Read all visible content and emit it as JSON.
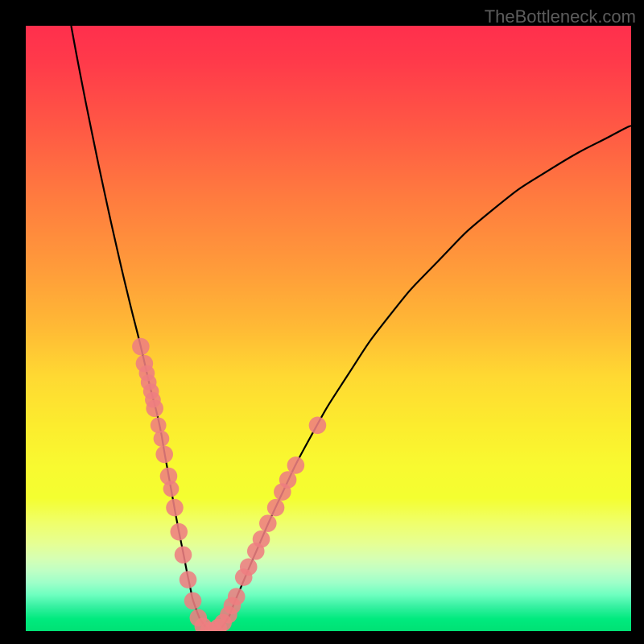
{
  "watermark": "TheBottleneck.com",
  "colors": {
    "frame": "#000000",
    "curve": "#000000",
    "dot_fill": "#ee7e81",
    "dot_stroke": "#ee7e81"
  },
  "chart_data": {
    "type": "line",
    "title": "",
    "xlabel": "",
    "ylabel": "",
    "xlim": [
      0,
      100
    ],
    "ylim": [
      0,
      100
    ],
    "series": [
      {
        "name": "bottleneck-curve",
        "x": [
          7.5,
          9,
          11,
          13,
          15,
          17,
          19,
          20.5,
          22,
          23,
          24,
          25,
          26,
          27,
          28,
          29.5,
          31,
          33,
          35,
          38,
          42,
          47,
          53,
          60,
          68,
          77,
          87,
          97,
          100
        ],
        "y": [
          100,
          92,
          82,
          72.5,
          63.5,
          55,
          47,
          40.5,
          34.5,
          29,
          23.5,
          18,
          13,
          8,
          4,
          1,
          0,
          1.5,
          6,
          13,
          22,
          32,
          42,
          52,
          61,
          69.5,
          76.5,
          82,
          83.5
        ]
      }
    ],
    "dots": [
      {
        "x": 19.0,
        "y": 47.0,
        "r": 1.2
      },
      {
        "x": 19.6,
        "y": 44.2,
        "r": 1.2
      },
      {
        "x": 20.0,
        "y": 42.6,
        "r": 1.0
      },
      {
        "x": 20.3,
        "y": 41.1,
        "r": 1.0
      },
      {
        "x": 20.7,
        "y": 39.6,
        "r": 1.0
      },
      {
        "x": 21.0,
        "y": 38.2,
        "r": 1.0
      },
      {
        "x": 21.3,
        "y": 36.8,
        "r": 1.2
      },
      {
        "x": 21.9,
        "y": 34.0,
        "r": 1.0
      },
      {
        "x": 22.4,
        "y": 31.8,
        "r": 1.0
      },
      {
        "x": 22.9,
        "y": 29.2,
        "r": 1.2
      },
      {
        "x": 23.6,
        "y": 25.6,
        "r": 1.2
      },
      {
        "x": 24.0,
        "y": 23.5,
        "r": 1.0
      },
      {
        "x": 24.6,
        "y": 20.4,
        "r": 1.2
      },
      {
        "x": 25.3,
        "y": 16.4,
        "r": 1.2
      },
      {
        "x": 26.0,
        "y": 12.6,
        "r": 1.2
      },
      {
        "x": 26.8,
        "y": 8.5,
        "r": 1.2
      },
      {
        "x": 27.6,
        "y": 5.0,
        "r": 1.2
      },
      {
        "x": 28.5,
        "y": 2.2,
        "r": 1.2
      },
      {
        "x": 29.3,
        "y": 0.8,
        "r": 1.2
      },
      {
        "x": 30.2,
        "y": 0.1,
        "r": 1.2
      },
      {
        "x": 31.0,
        "y": 0.1,
        "r": 1.2
      },
      {
        "x": 31.8,
        "y": 0.6,
        "r": 1.2
      },
      {
        "x": 32.6,
        "y": 1.4,
        "r": 1.2
      },
      {
        "x": 33.5,
        "y": 2.7,
        "r": 1.2
      },
      {
        "x": 34.1,
        "y": 4.2,
        "r": 1.2
      },
      {
        "x": 34.8,
        "y": 5.7,
        "r": 1.2
      },
      {
        "x": 36.0,
        "y": 8.9,
        "r": 1.2
      },
      {
        "x": 36.8,
        "y": 10.6,
        "r": 1.2
      },
      {
        "x": 38.0,
        "y": 13.2,
        "r": 1.2
      },
      {
        "x": 38.9,
        "y": 15.2,
        "r": 1.2
      },
      {
        "x": 40.0,
        "y": 17.8,
        "r": 1.2
      },
      {
        "x": 41.3,
        "y": 20.4,
        "r": 1.2
      },
      {
        "x": 42.4,
        "y": 23.0,
        "r": 1.2
      },
      {
        "x": 43.3,
        "y": 25.0,
        "r": 1.2
      },
      {
        "x": 44.6,
        "y": 27.4,
        "r": 1.2
      },
      {
        "x": 48.2,
        "y": 34.0,
        "r": 1.2
      }
    ],
    "annotations": []
  }
}
